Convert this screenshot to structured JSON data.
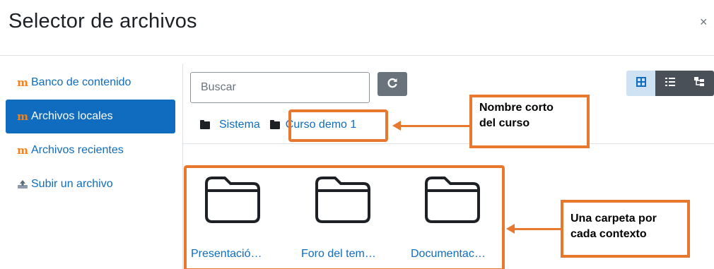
{
  "dialog": {
    "title": "Selector de archivos",
    "close_symbol": "×"
  },
  "sidebar": {
    "items": [
      {
        "label": "Banco de contenido",
        "icon": "moodle-logo-icon",
        "active": false
      },
      {
        "label": "Archivos locales",
        "icon": "moodle-logo-icon",
        "active": true
      },
      {
        "label": "Archivos recientes",
        "icon": "moodle-logo-icon",
        "active": false
      },
      {
        "label": "Subir un archivo",
        "icon": "upload-icon",
        "active": false
      }
    ]
  },
  "toolbar": {
    "search_placeholder": "Buscar",
    "refresh_icon": "refresh-icon",
    "view_modes": [
      {
        "name": "icons-view",
        "icon": "grid-icon",
        "selected": true
      },
      {
        "name": "list-view",
        "icon": "list-icon",
        "selected": false
      },
      {
        "name": "tree-view",
        "icon": "tree-icon",
        "selected": false
      }
    ]
  },
  "breadcrumb": {
    "items": [
      "Sistema",
      "Curso demo 1"
    ]
  },
  "annotations": {
    "short_name": "Nombre corto\ndel curso",
    "per_context": "Una carpeta por\ncada contexto",
    "color": "#e8782e"
  },
  "files": [
    {
      "name": "Presentació…",
      "icon": "folder-icon"
    },
    {
      "name": "Foro del tem…",
      "icon": "folder-icon"
    },
    {
      "name": "Documentac…",
      "icon": "folder-icon"
    }
  ],
  "colors": {
    "accent": "#0f6cbf",
    "moodle_orange": "#f98012",
    "refresh_bg": "#6a737b"
  }
}
